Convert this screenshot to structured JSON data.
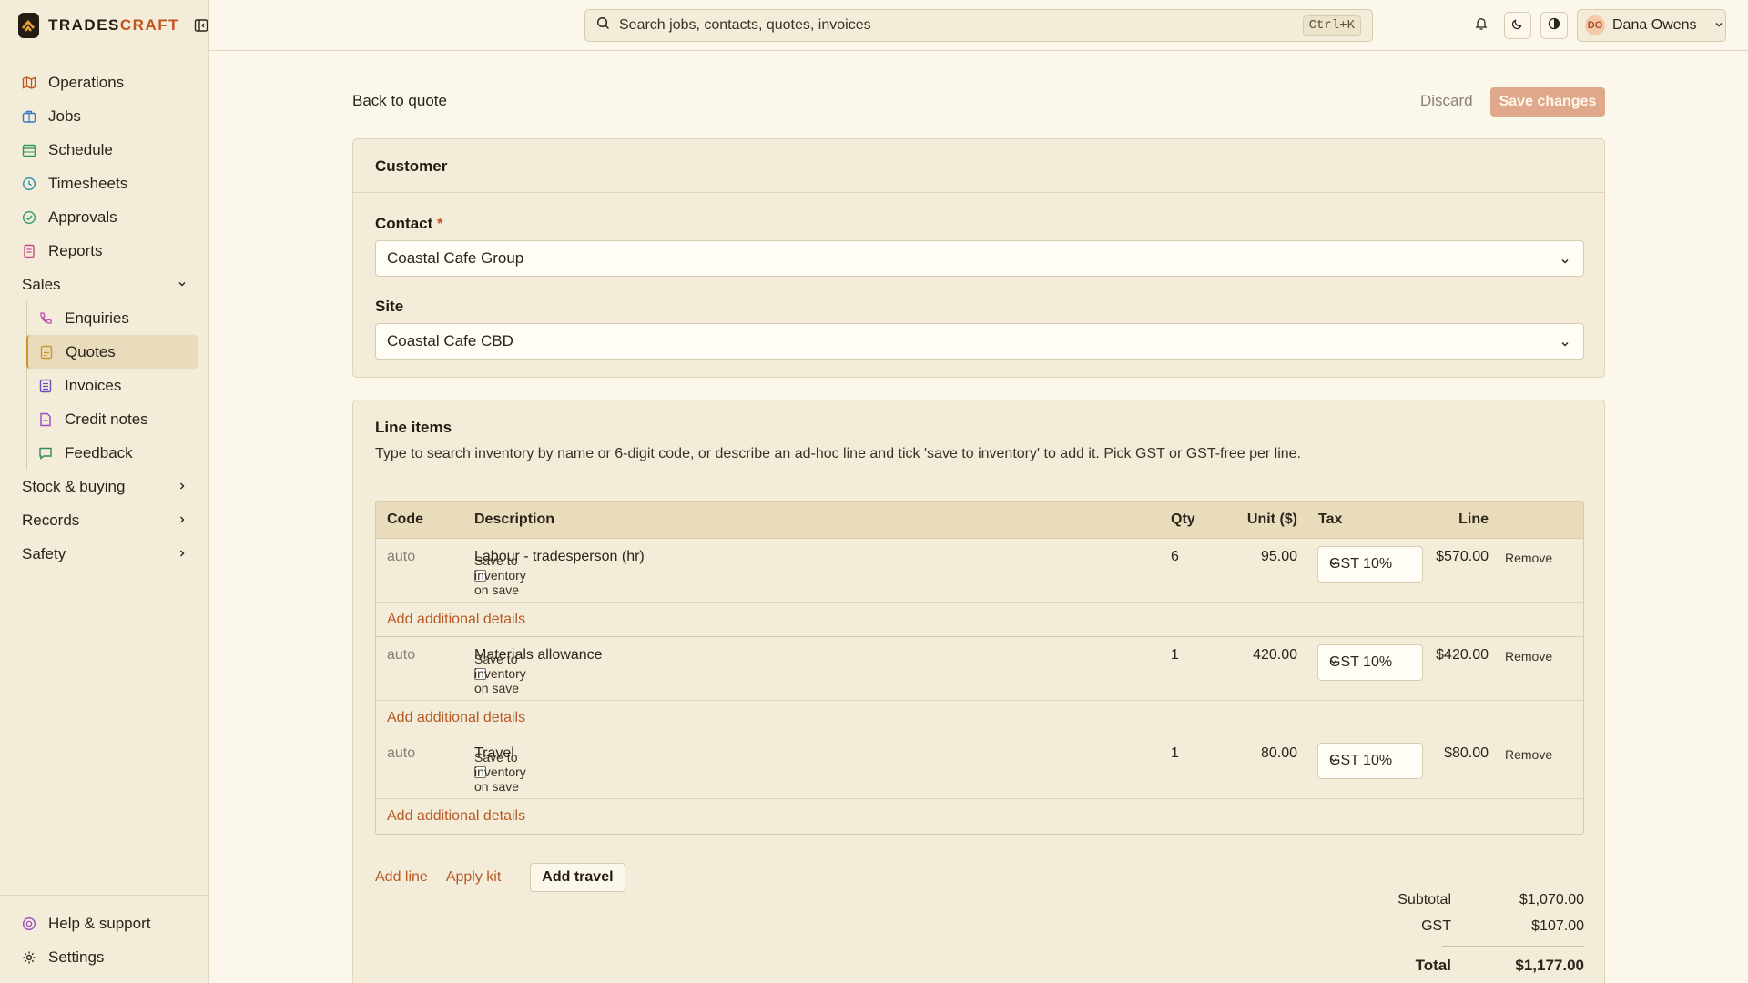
{
  "app": {
    "brand_prefix": "TRADES",
    "brand_suffix": "CRAFT"
  },
  "colors": {
    "accent": "#c2541e",
    "link": "#b65a25",
    "sidebar_bg": "#f3ecd9",
    "page_bg": "#fbf7eb"
  },
  "sidebar": {
    "items": [
      {
        "label": "Operations",
        "icon": "map-icon"
      },
      {
        "label": "Jobs",
        "icon": "briefcase-icon"
      },
      {
        "label": "Schedule",
        "icon": "calendar-icon"
      },
      {
        "label": "Timesheets",
        "icon": "clock-icon"
      },
      {
        "label": "Approvals",
        "icon": "check-circle-icon"
      },
      {
        "label": "Reports",
        "icon": "report-icon"
      }
    ],
    "sales_label": "Sales",
    "sales_items": [
      {
        "label": "Enquiries",
        "icon": "phone-icon"
      },
      {
        "label": "Quotes",
        "icon": "quote-icon",
        "active": true
      },
      {
        "label": "Invoices",
        "icon": "invoice-icon"
      },
      {
        "label": "Credit notes",
        "icon": "credit-note-icon"
      },
      {
        "label": "Feedback",
        "icon": "chat-icon"
      }
    ],
    "groups": [
      "Stock & buying",
      "Records",
      "Safety"
    ],
    "bottom": [
      {
        "label": "Help & support",
        "icon": "lifebuoy-icon"
      },
      {
        "label": "Settings",
        "icon": "gear-icon"
      }
    ]
  },
  "topbar": {
    "search_placeholder": "Search jobs, contacts, quotes, invoices",
    "shortcut": "Ctrl+K",
    "user_initials": "DO",
    "user_name": "Dana Owens"
  },
  "page": {
    "back_label": "Back to quote",
    "discard_label": "Discard",
    "save_label": "Save changes"
  },
  "customer": {
    "title": "Customer",
    "contact_label": "Contact",
    "contact_required": "*",
    "contact_value": "Coastal Cafe Group",
    "site_label": "Site",
    "site_value": "Coastal Cafe CBD"
  },
  "line_items": {
    "title": "Line items",
    "description": "Type to search inventory by name or 6-digit code, or describe an ad-hoc line and tick 'save to inventory' to add it. Pick GST or GST-free per line.",
    "columns": {
      "code": "Code",
      "description": "Description",
      "qty": "Qty",
      "unit": "Unit ($)",
      "tax": "Tax",
      "line": "Line"
    },
    "save_to_inventory_label": "Save to inventory on save",
    "add_details_label": "Add additional details",
    "remove_label": "Remove",
    "rows": [
      {
        "code": "auto",
        "description": "Labour - tradesperson (hr)",
        "qty": "6",
        "unit": "95.00",
        "tax": "GST 10%",
        "line": "$570.00"
      },
      {
        "code": "auto",
        "description": "Materials allowance",
        "qty": "1",
        "unit": "420.00",
        "tax": "GST 10%",
        "line": "$420.00"
      },
      {
        "code": "auto",
        "description": "Travel",
        "qty": "1",
        "unit": "80.00",
        "tax": "GST 10%",
        "line": "$80.00"
      }
    ],
    "add_line_label": "Add line",
    "apply_kit_label": "Apply kit",
    "add_travel_label": "Add travel"
  },
  "totals": {
    "subtotal_label": "Subtotal",
    "subtotal_value": "$1,070.00",
    "gst_label": "GST",
    "gst_value": "$107.00",
    "total_label": "Total",
    "total_value": "$1,177.00"
  }
}
